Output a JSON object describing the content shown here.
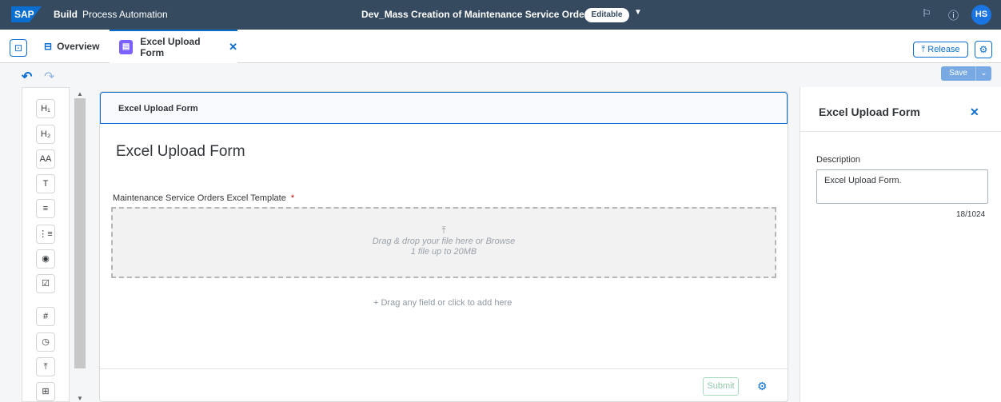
{
  "shell": {
    "logo": "SAP",
    "build": "Build",
    "app": "Process Automation",
    "project": "Dev_Mass Creation of Maintenance Service Orders",
    "badge": "Editable",
    "avatar": "HS"
  },
  "tabs": [
    {
      "label": "Overview",
      "icon": "overview-icon"
    },
    {
      "label": "Excel Upload Form",
      "icon": "document-icon",
      "active": true
    }
  ],
  "toolbar": {
    "release_label": "Release",
    "save_label": "Save"
  },
  "palette": {
    "items": [
      {
        "icon": "heading1-icon",
        "glyph": "H₁"
      },
      {
        "icon": "heading2-icon",
        "glyph": "H₂"
      },
      {
        "icon": "text-style-icon",
        "glyph": "AA"
      },
      {
        "icon": "text-icon",
        "glyph": "T"
      },
      {
        "icon": "paragraph-icon",
        "glyph": "≡"
      },
      {
        "icon": "list-icon",
        "glyph": "⋮≡"
      },
      {
        "icon": "radio-icon",
        "glyph": "◉"
      },
      {
        "icon": "checkbox-icon",
        "glyph": "☑"
      },
      {
        "icon": "number-icon",
        "glyph": "#"
      },
      {
        "icon": "date-icon",
        "glyph": "◷"
      },
      {
        "icon": "upload-icon",
        "glyph": "⤒"
      },
      {
        "icon": "table-icon",
        "glyph": "⊞"
      }
    ]
  },
  "form": {
    "header": "Excel Upload Form",
    "title": "Excel Upload Form",
    "field_label": "Maintenance Service Orders Excel Template",
    "required_mark": "*",
    "drop_line1": "Drag & drop your file here or Browse",
    "drop_line2": "1 file up to 20MB",
    "add_field": "Drag any field or click to add here",
    "submit_label": "Submit"
  },
  "panel": {
    "title": "Excel Upload Form",
    "description_label": "Description",
    "description_value": "Excel Upload Form.",
    "char_count": "18/1024"
  },
  "colors": {
    "shell": "#354a5f",
    "accent": "#0a6ed1"
  }
}
